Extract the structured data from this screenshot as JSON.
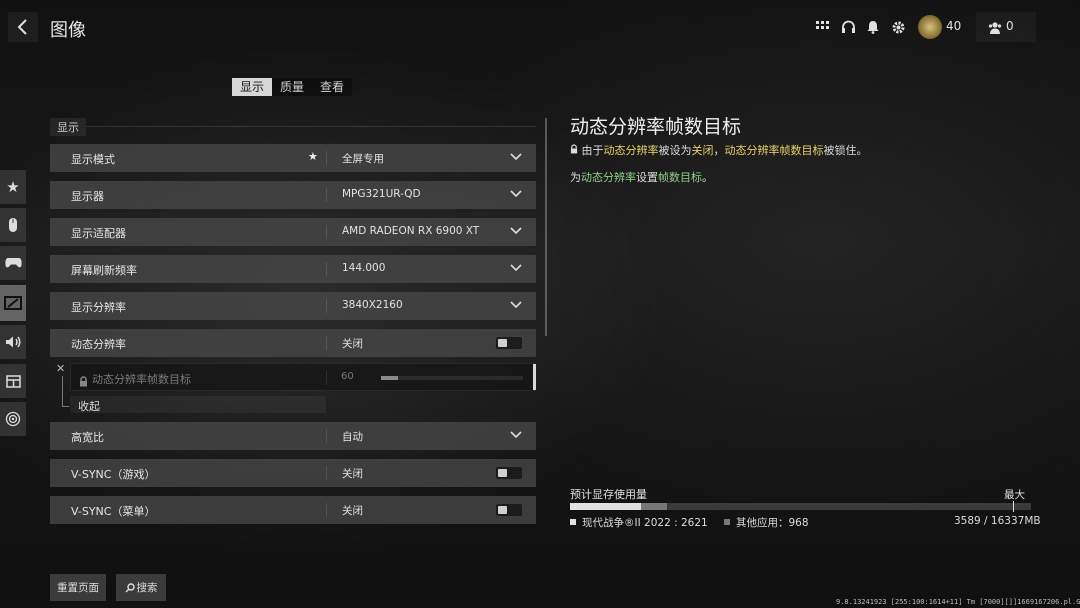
{
  "header": {
    "title": "图像",
    "coins": "40",
    "friends": "0"
  },
  "tabs": [
    {
      "label": "显示",
      "active": true
    },
    {
      "label": "质量",
      "active": false
    },
    {
      "label": "查看",
      "active": false
    }
  ],
  "section": {
    "label": "显示"
  },
  "settings": [
    {
      "label": "显示模式",
      "value": "全屏专用",
      "control": "dropdown",
      "starred": true
    },
    {
      "label": "显示器",
      "value": "MPG321UR-QD",
      "control": "dropdown"
    },
    {
      "label": "显示适配器",
      "value": "AMD RADEON RX 6900 XT",
      "control": "dropdown"
    },
    {
      "label": "屏幕刷新频率",
      "value": "144.000",
      "control": "dropdown"
    },
    {
      "label": "显示分辨率",
      "value": "3840X2160",
      "control": "dropdown"
    },
    {
      "label": "动态分辨率",
      "value": "关闭",
      "control": "toggle"
    },
    {
      "label": "高宽比",
      "value": "自动",
      "control": "dropdown"
    },
    {
      "label": "V-SYNC（游戏）",
      "value": "关闭",
      "control": "toggle"
    },
    {
      "label": "V-SYNC（菜单）",
      "value": "关闭",
      "control": "toggle"
    }
  ],
  "sub_setting": {
    "label": "动态分辨率帧数目标",
    "value": "60",
    "locked": true,
    "slider_fraction": 0.12,
    "collapse_label": "收起"
  },
  "info": {
    "title": "动态分辨率帧数目标",
    "line1": {
      "prefix": "由于",
      "hl1": "动态分辨率",
      "mid1": "被设为",
      "hl2": "关闭",
      "mid2": "，",
      "hl3": "动态分辨率帧数目标",
      "suffix": "被锁住。"
    },
    "line2": {
      "prefix": "为",
      "hl1": "动态分辨率",
      "mid": "设置",
      "hl2": "帧数目标",
      "suffix": "。"
    }
  },
  "vram": {
    "title": "预计显存使用量",
    "max_label": "最大",
    "game_label": "现代战争®II 2022 : 2621",
    "other_label": "其他应用：968",
    "total": "3589 / 16337MB",
    "game_mb": 2621,
    "other_mb": 968,
    "max_mb": 16337
  },
  "footer": {
    "reset_label": "重置页面",
    "search_label": "搜索",
    "build": "9.8.13241923 [255:100:1614+11] Tm [7000][]]1669167206.pl.G.steam"
  },
  "colors": {
    "highlight_yellow": "#e8d36a",
    "highlight_green": "#8fd18a"
  }
}
